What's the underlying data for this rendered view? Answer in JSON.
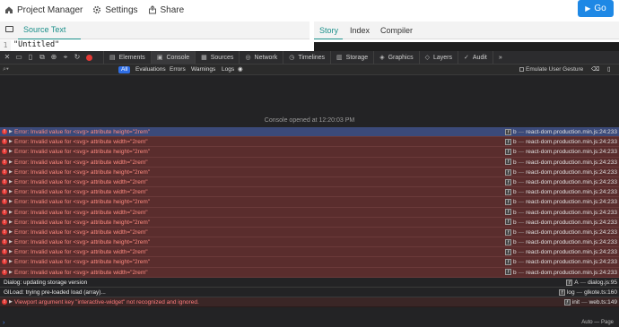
{
  "topbar": {
    "project_manager": "Project Manager",
    "settings": "Settings",
    "share": "Share",
    "go": "Go"
  },
  "editor": {
    "source_tab": "Source Text",
    "line_number": "1",
    "code": "\"Untitled\"",
    "right_tabs": [
      "Story",
      "Index",
      "Compiler"
    ]
  },
  "devtools": {
    "tabs": [
      "Elements",
      "Console",
      "Sources",
      "Network",
      "Timelines",
      "Storage",
      "Graphics",
      "Layers",
      "Audit"
    ],
    "active_tab": "Console"
  },
  "filter": {
    "chips": [
      "All",
      "Evaluations",
      "Errors",
      "Warnings",
      "Logs"
    ],
    "active_chip": "All",
    "emulate": "Emulate User Gesture"
  },
  "console": {
    "opened_text": "Console opened at 12:20:03 PM",
    "error_rows": [
      {
        "msg": "Error: Invalid value for <svg> attribute height=\"2rem\"",
        "fn": "b",
        "src": "react-dom.production.min.js:24:233"
      },
      {
        "msg": "Error: Invalid value for <svg> attribute width=\"2rem\"",
        "fn": "b",
        "src": "react-dom.production.min.js:24:233"
      },
      {
        "msg": "Error: Invalid value for <svg> attribute height=\"2rem\"",
        "fn": "b",
        "src": "react-dom.production.min.js:24:233"
      },
      {
        "msg": "Error: Invalid value for <svg> attribute width=\"2rem\"",
        "fn": "b",
        "src": "react-dom.production.min.js:24:233"
      },
      {
        "msg": "Error: Invalid value for <svg> attribute height=\"2rem\"",
        "fn": "b",
        "src": "react-dom.production.min.js:24:233"
      },
      {
        "msg": "Error: Invalid value for <svg> attribute width=\"2rem\"",
        "fn": "b",
        "src": "react-dom.production.min.js:24:233"
      },
      {
        "msg": "Error: Invalid value for <svg> attribute width=\"2rem\"",
        "fn": "b",
        "src": "react-dom.production.min.js:24:233"
      },
      {
        "msg": "Error: Invalid value for <svg> attribute height=\"2rem\"",
        "fn": "b",
        "src": "react-dom.production.min.js:24:233"
      },
      {
        "msg": "Error: Invalid value for <svg> attribute width=\"2rem\"",
        "fn": "b",
        "src": "react-dom.production.min.js:24:233"
      },
      {
        "msg": "Error: Invalid value for <svg> attribute height=\"2rem\"",
        "fn": "b",
        "src": "react-dom.production.min.js:24:233"
      },
      {
        "msg": "Error: Invalid value for <svg> attribute width=\"2rem\"",
        "fn": "b",
        "src": "react-dom.production.min.js:24:233"
      },
      {
        "msg": "Error: Invalid value for <svg> attribute height=\"2rem\"",
        "fn": "b",
        "src": "react-dom.production.min.js:24:233"
      },
      {
        "msg": "Error: Invalid value for <svg> attribute width=\"2rem\"",
        "fn": "b",
        "src": "react-dom.production.min.js:24:233"
      },
      {
        "msg": "Error: Invalid value for <svg> attribute height=\"2rem\"",
        "fn": "b",
        "src": "react-dom.production.min.js:24:233"
      },
      {
        "msg": "Error: Invalid value for <svg> attribute width=\"2rem\"",
        "fn": "b",
        "src": "react-dom.production.min.js:24:233"
      }
    ],
    "log_rows": [
      {
        "msg": "Dialog: updating storage version",
        "fn": "A",
        "src": "dialog.js:95"
      },
      {
        "msg": "GlLoad: trying pre-loaded load (array)...",
        "fn": "log",
        "src": "glkote.ts:160"
      }
    ],
    "last_error": {
      "msg": "Viewport argument key \"interactive-widget\" not recognized and ignored.",
      "fn": "init",
      "src": "web.ts:149"
    },
    "bottom_auto": "Auto — Page"
  },
  "colors": {
    "accent": "#1a8f8a",
    "go": "#1e88e5",
    "error_row": "#5a2d2d",
    "selected_row": "#3b4a7a",
    "console_bg": "#232325"
  }
}
